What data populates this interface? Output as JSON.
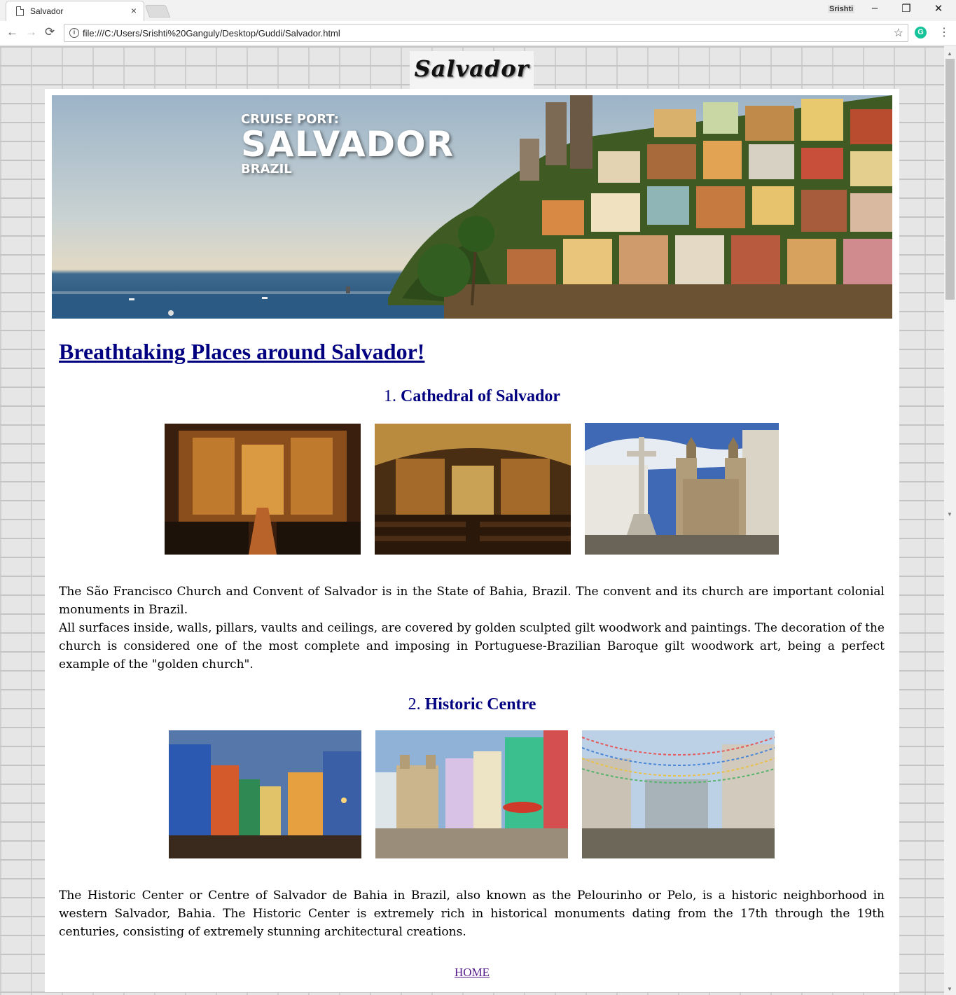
{
  "browser": {
    "tab_title": "Salvador",
    "tab_close": "×",
    "profile_name": "Srishti",
    "url": "file:///C:/Users/Srishti%20Ganguly/Desktop/Guddi/Salvador.html",
    "back": "←",
    "forward": "→",
    "reload": "⟳",
    "minimize": "–",
    "restore": "❐",
    "close": "✕",
    "star": "☆",
    "extension_letter": "G",
    "menu": "⋮",
    "info": "i"
  },
  "page": {
    "logo": "Salvador",
    "banner": {
      "subtitle": "CRUISE PORT:",
      "title": "SALVADOR",
      "country": "BRAZIL"
    },
    "section_title": "Breathtaking Places around Salvador!",
    "places": [
      {
        "number": "1.",
        "name": "Cathedral of Salvador",
        "description": [
          "The São Francisco Church and Convent of Salvador is in the State of Bahia, Brazil. The convent and its church are important colonial monuments in Brazil.",
          "All surfaces inside, walls, pillars, vaults and ceilings, are covered by golden sculpted gilt woodwork and paintings. The decoration of the church is considered one of the most complete and imposing in Portuguese-Brazilian  Baroque gilt woodwork art, being a perfect example of the \"golden church\"."
        ]
      },
      {
        "number": "2.",
        "name": "Historic Centre",
        "description": [
          "The Historic Center or Centre of Salvador de Bahia in Brazil, also known as the Pelourinho or Pelo, is a historic neighborhood in western Salvador, Bahia. The Historic Center is extremely rich in historical monuments dating from the 17th through the 19th centuries, consisting of extremely stunning architectural creations."
        ]
      }
    ],
    "home_link": "HOME"
  }
}
